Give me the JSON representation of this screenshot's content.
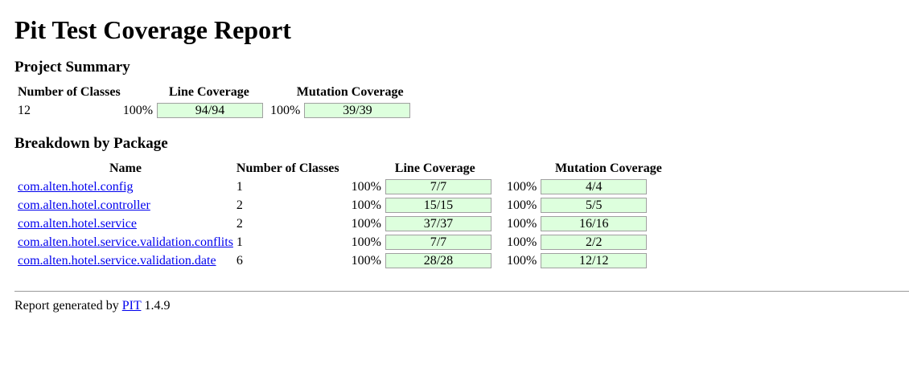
{
  "title": "Pit Test Coverage Report",
  "summary": {
    "heading": "Project Summary",
    "headers": {
      "classes": "Number of Classes",
      "line": "Line Coverage",
      "mutation": "Mutation Coverage"
    },
    "classes": "12",
    "line_pct": "100%",
    "line_ratio": "94/94",
    "mutation_pct": "100%",
    "mutation_ratio": "39/39"
  },
  "breakdown": {
    "heading": "Breakdown by Package",
    "headers": {
      "name": "Name",
      "classes": "Number of Classes",
      "line": "Line Coverage",
      "mutation": "Mutation Coverage"
    },
    "rows": [
      {
        "name": "com.alten.hotel.config",
        "classes": "1",
        "line_pct": "100%",
        "line_ratio": "7/7",
        "mutation_pct": "100%",
        "mutation_ratio": "4/4"
      },
      {
        "name": "com.alten.hotel.controller",
        "classes": "2",
        "line_pct": "100%",
        "line_ratio": "15/15",
        "mutation_pct": "100%",
        "mutation_ratio": "5/5"
      },
      {
        "name": "com.alten.hotel.service",
        "classes": "2",
        "line_pct": "100%",
        "line_ratio": "37/37",
        "mutation_pct": "100%",
        "mutation_ratio": "16/16"
      },
      {
        "name": "com.alten.hotel.service.validation.conflits",
        "classes": "1",
        "line_pct": "100%",
        "line_ratio": "7/7",
        "mutation_pct": "100%",
        "mutation_ratio": "2/2"
      },
      {
        "name": "com.alten.hotel.service.validation.date",
        "classes": "6",
        "line_pct": "100%",
        "line_ratio": "28/28",
        "mutation_pct": "100%",
        "mutation_ratio": "12/12"
      }
    ]
  },
  "footer": {
    "prefix": "Report generated by",
    "link": "PIT",
    "version": "1.4.9"
  },
  "colors": {
    "bar_fill": "#ddffdd",
    "bar_border": "#a0a0a0",
    "link": "#0000ee"
  }
}
